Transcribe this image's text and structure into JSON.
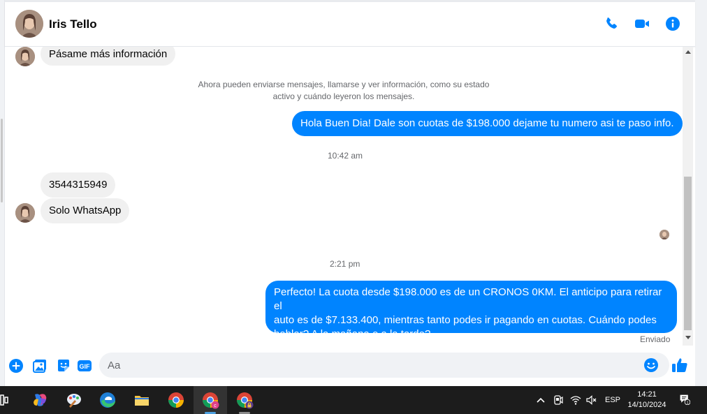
{
  "conversation": {
    "contact_name": "Iris Tello",
    "header_actions": [
      "phone-icon",
      "video-icon",
      "info-icon"
    ]
  },
  "messages": {
    "m1": "Pásame más información",
    "system_notice": {
      "line1": "Ahora pueden enviarse mensajes, llamarse y ver información, como su estado",
      "line2": "activo y cuándo leyeron los mensajes."
    },
    "m2": "Hola Buen Dia! Dale son cuotas de $198.000 dejame tu numero asi te paso info.",
    "time1": "10:42 am",
    "m3": "3544315949",
    "m4": "Solo WhatsApp",
    "time2": "2:21 pm",
    "m5": {
      "line1": "Perfecto! La cuota desde $198.000 es de un CRONOS 0KM. El anticipo para retirar el",
      "line2": "auto es de $7.133.400, mientras tanto podes ir pagando en cuotas. Cuándo podes",
      "line3": "hablar? A la mañana o a la tarde?"
    },
    "status": "Enviado"
  },
  "composer": {
    "placeholder": "Aa",
    "actions": [
      "plus-icon",
      "photo-icon",
      "sticker-icon",
      "gif-icon",
      "emoji-icon",
      "thumbs-up-icon"
    ],
    "gif_label": "GIF"
  },
  "taskbar": {
    "language": "ESP",
    "time": "14:21",
    "date": "14/10/2024",
    "notification_count": "1",
    "apps": [
      "copilot-icon",
      "paint-icon",
      "edge-icon",
      "file-explorer-icon",
      "chrome-icon",
      "chrome-profile-c-icon",
      "chrome-profile-lock-icon"
    ]
  },
  "colors": {
    "accent": "#0084ff",
    "incoming_bubble": "#f0f0f0",
    "taskbar": "#1c1c1c"
  }
}
